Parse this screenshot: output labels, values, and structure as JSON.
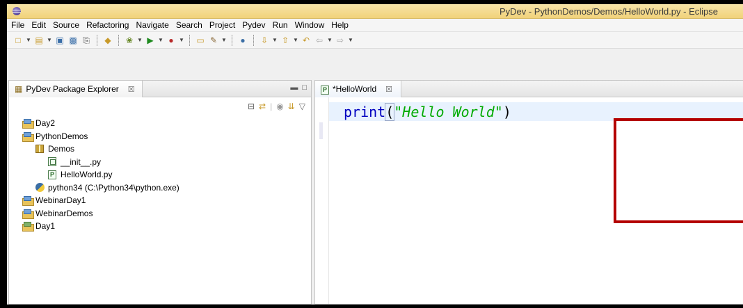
{
  "window": {
    "title": "PyDev - PythonDemos/Demos/HelloWorld.py - Eclipse"
  },
  "menu": {
    "items": [
      "File",
      "Edit",
      "Source",
      "Refactoring",
      "Navigate",
      "Search",
      "Project",
      "Pydev",
      "Run",
      "Window",
      "Help"
    ]
  },
  "explorer": {
    "tab_label": "PyDev Package Explorer",
    "close_glyph": "☒",
    "tree": [
      {
        "label": "Day2",
        "icon": "project-icon",
        "indent": 0
      },
      {
        "label": "PythonDemos",
        "icon": "project-icon",
        "indent": 0
      },
      {
        "label": "Demos",
        "icon": "package-icon",
        "indent": 1
      },
      {
        "label": "__init__.py",
        "icon": "python-init-file-icon",
        "indent": 2
      },
      {
        "label": "HelloWorld.py",
        "icon": "python-file-icon",
        "indent": 2
      },
      {
        "label": "python34  (C:\\Python34\\python.exe)",
        "icon": "python-interpreter-icon",
        "indent": 1
      },
      {
        "label": "WebinarDay1",
        "icon": "project-icon",
        "indent": 0
      },
      {
        "label": "WebinarDemos",
        "icon": "project-icon",
        "indent": 0
      },
      {
        "label": "Day1",
        "icon": "closed-project-icon",
        "indent": 0
      }
    ]
  },
  "editor": {
    "tab_label": "*HelloWorld",
    "close_glyph": "☒",
    "code": {
      "fn": "print",
      "open_paren": "(",
      "string": "\"Hello World\"",
      "close_paren": ")"
    }
  },
  "colors": {
    "highlight_box": "#b40000",
    "titlebar": "#f1d27a",
    "string": "#00aa00",
    "keyword": "#0000c0"
  }
}
